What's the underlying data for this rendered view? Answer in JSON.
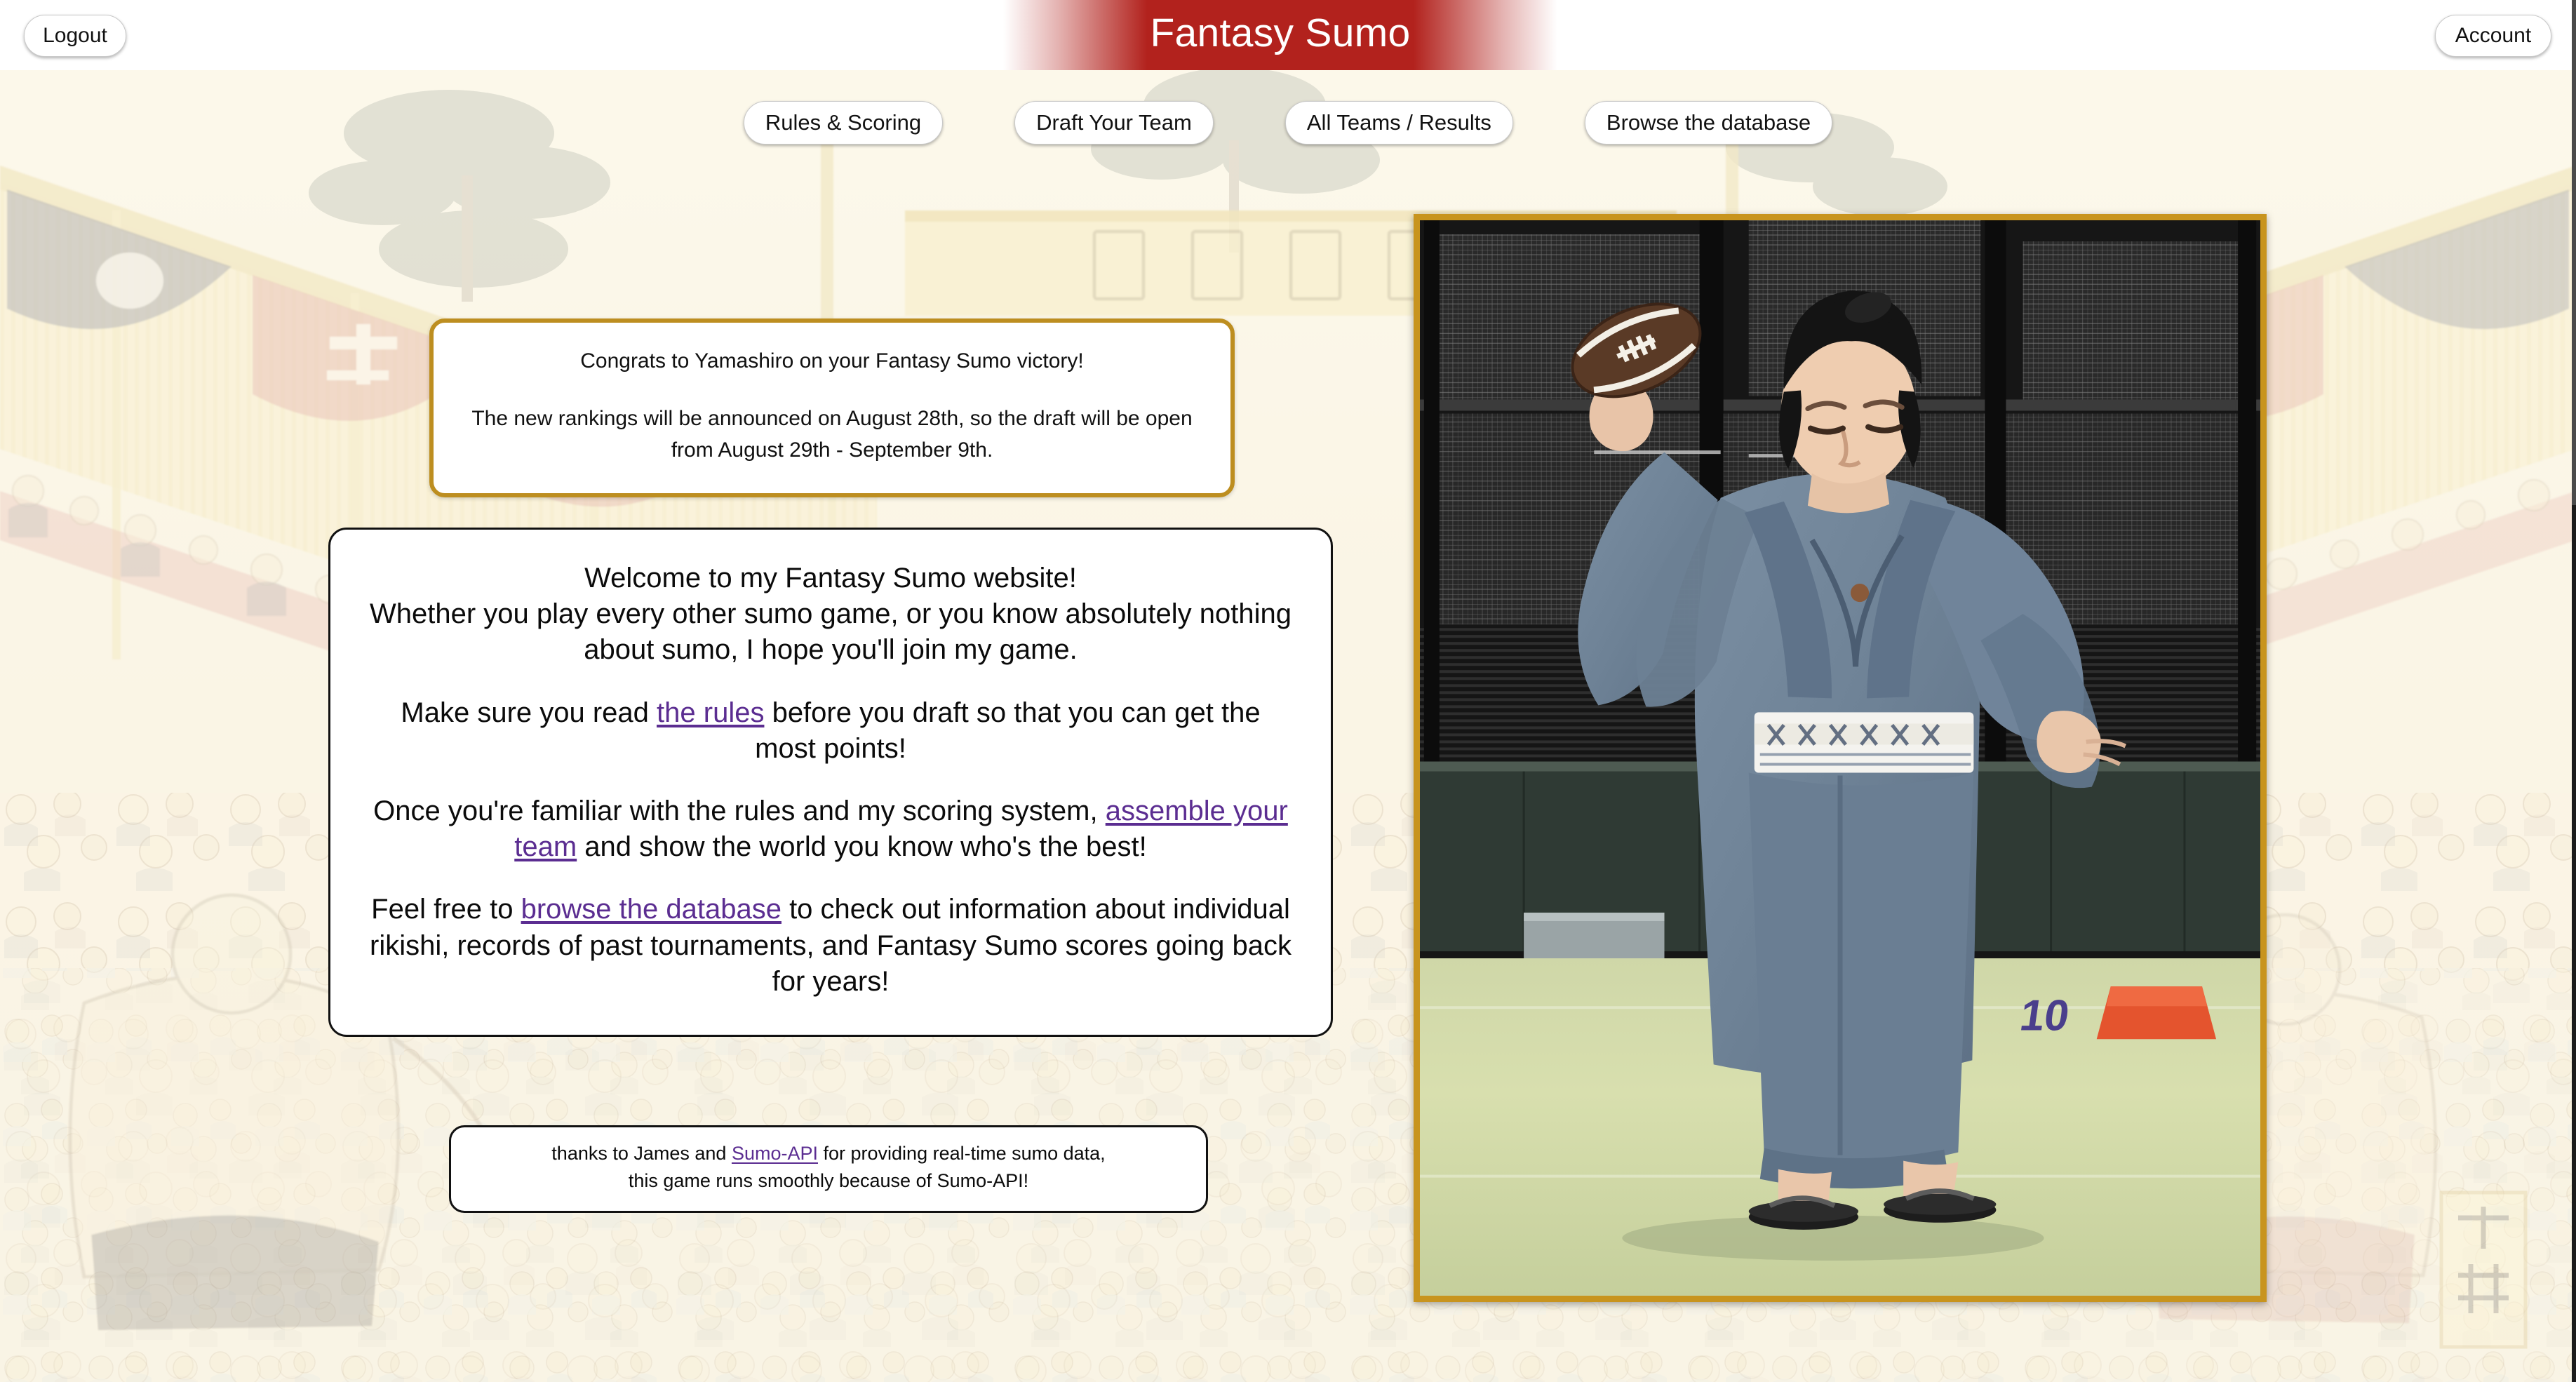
{
  "header": {
    "title": "Fantasy Sumo",
    "logout_label": "Logout",
    "account_label": "Account",
    "banner_color": "#b2221d",
    "banner_text_color": "#ffffff"
  },
  "nav": {
    "items": [
      {
        "label": "Rules & Scoring"
      },
      {
        "label": "Draft Your Team"
      },
      {
        "label": "All Teams / Results"
      },
      {
        "label": "Browse the database"
      }
    ]
  },
  "announcement": {
    "border_color": "#bd8e20",
    "line1": "Congrats to Yamashiro on your Fantasy Sumo victory!",
    "line2": "The new rankings will be announced on August 28th, so the draft will be open from August 29th - September 9th."
  },
  "welcome": {
    "p1_line1": "Welcome to my Fantasy Sumo website!",
    "p1_line2": "Whether you play every other sumo game, or you know absolutely nothing about sumo, I hope you'll join my game.",
    "p2_before": "Make sure you read ",
    "p2_link": "the rules",
    "p2_after": " before you draft so that you can get the most points!",
    "p3_before": "Once you're familiar with the rules and my scoring system, ",
    "p3_link": "assemble your team",
    "p3_after": " and show the world you know who's the best!",
    "p4_before": "Feel free to ",
    "p4_link": "browse the database",
    "p4_after": " to check out information about individual rikishi, records of past tournaments, and Fantasy Sumo scores going back for years!",
    "link_color": "#5b2d91"
  },
  "credit": {
    "line1_before": "thanks to James and ",
    "line1_link": "Sumo-API",
    "line1_after": " for providing real-time sumo data,",
    "line2": "this game runs smoothly because of Sumo-API!"
  },
  "photo": {
    "alt": "Sumo wrestler in gray yukata throwing an American football on a sports field",
    "frame_color": "#c8941e",
    "field_marker": "10"
  },
  "background": {
    "alt": "Faded ukiyo-e woodblock print of a sumo tournament crowd",
    "base_color": "#f7f2e2"
  }
}
